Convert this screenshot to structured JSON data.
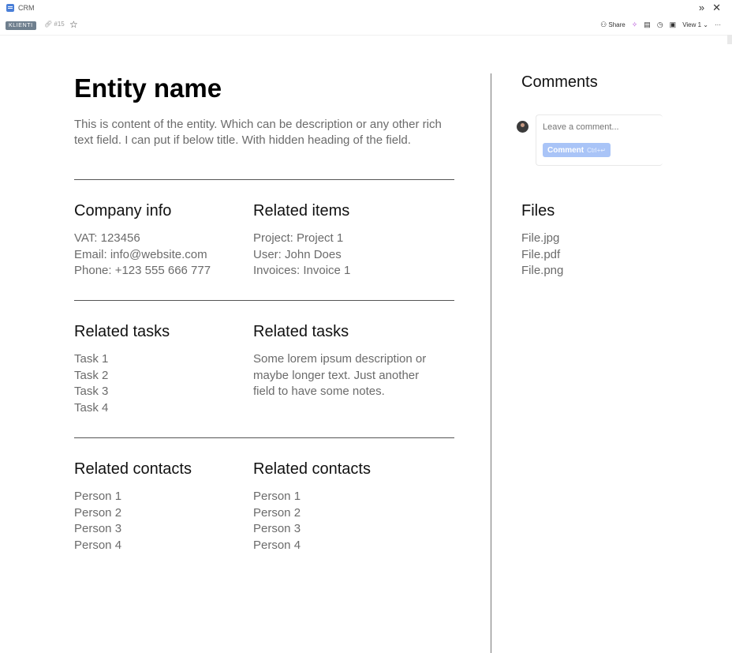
{
  "window": {
    "app_name": "CRM"
  },
  "subbar": {
    "badge": "KLIENTI",
    "link_id": "#15",
    "share_label": "Share",
    "view_label": "View 1"
  },
  "entity": {
    "title": "Entity name",
    "description": "This is content of the entity. Which can be description or any other rich text field. I can put if below title. With hidden heading of the field."
  },
  "sections": {
    "company_info": {
      "heading": "Company info",
      "lines": [
        "VAT: 123456",
        "Email: info@website.com",
        "Phone: +123 555 666 777"
      ]
    },
    "related_items": {
      "heading": "Related items",
      "lines": [
        "Project: Project 1",
        "User: John Does",
        "Invoices: Invoice 1"
      ]
    },
    "related_tasks": {
      "heading": "Related tasks",
      "lines": [
        "Task 1",
        "Task 2",
        "Task 3",
        "Task 4"
      ]
    },
    "related_tasks_notes": {
      "heading": "Related tasks",
      "text": "Some lorem ipsum description or maybe longer text. Just another field to have some notes."
    },
    "related_contacts_a": {
      "heading": "Related contacts",
      "lines": [
        "Person 1",
        "Person 2",
        "Person 3",
        "Person 4"
      ]
    },
    "related_contacts_b": {
      "heading": "Related contacts",
      "lines": [
        "Person 1",
        "Person 2",
        "Person 3",
        "Person 4"
      ]
    }
  },
  "comments": {
    "heading": "Comments",
    "placeholder": "Leave a comment...",
    "button_label": "Comment",
    "shortcut": "Ctrl+↵"
  },
  "files": {
    "heading": "Files",
    "items": [
      "File.jpg",
      "File.pdf",
      "File.png"
    ]
  },
  "colors": {
    "accent": "#a9c4f7",
    "badge_bg": "#6f7f8e",
    "ai_icon": "#b24ad6"
  },
  "icons": [
    "app-icon",
    "link-icon",
    "star-icon",
    "share-icon",
    "ai-sparkle-icon",
    "comment-icon",
    "clock-icon",
    "image-icon",
    "chevron-down-icon",
    "more-icon",
    "expand-icon",
    "close-icon"
  ]
}
